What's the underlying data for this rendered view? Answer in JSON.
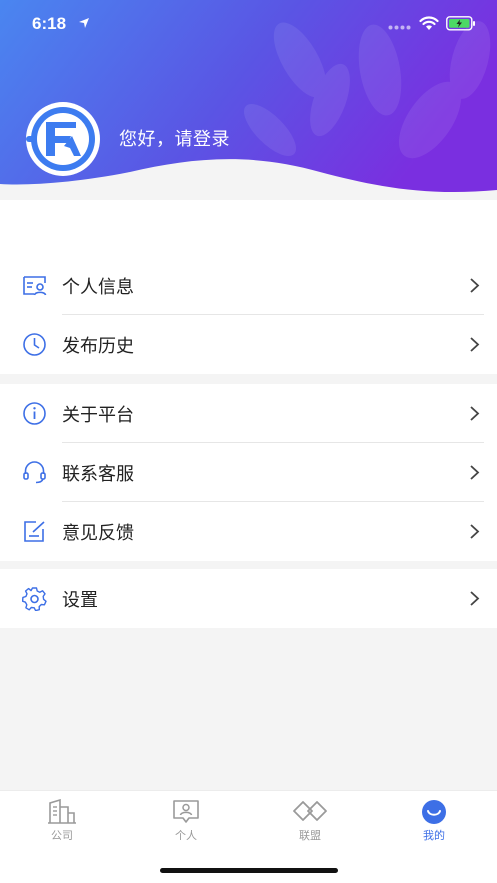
{
  "status_bar": {
    "time": "6:18"
  },
  "header": {
    "greeting": "您好，请登录",
    "gradient_start": "#4a86f0",
    "gradient_end": "#7a2fe0"
  },
  "menu_groups": [
    {
      "items": [
        {
          "label": "个人信息",
          "icon": "id-card-icon"
        },
        {
          "label": "发布历史",
          "icon": "clock-icon"
        }
      ]
    },
    {
      "items": [
        {
          "label": "关于平台",
          "icon": "info-icon"
        },
        {
          "label": "联系客服",
          "icon": "headset-icon"
        },
        {
          "label": "意见反馈",
          "icon": "feedback-edit-icon"
        }
      ]
    },
    {
      "items": [
        {
          "label": "设置",
          "icon": "gear-icon"
        }
      ]
    }
  ],
  "tabbar": {
    "tabs": [
      {
        "label": "公司",
        "icon": "building-icon",
        "active": false
      },
      {
        "label": "个人",
        "icon": "person-icon",
        "active": false
      },
      {
        "label": "联盟",
        "icon": "alliance-icon",
        "active": false
      },
      {
        "label": "我的",
        "icon": "smile-icon",
        "active": true
      }
    ]
  },
  "colors": {
    "accent": "#3d6fe6",
    "icon_blue": "#3d6fe6",
    "inactive": "#9a9a9a"
  }
}
